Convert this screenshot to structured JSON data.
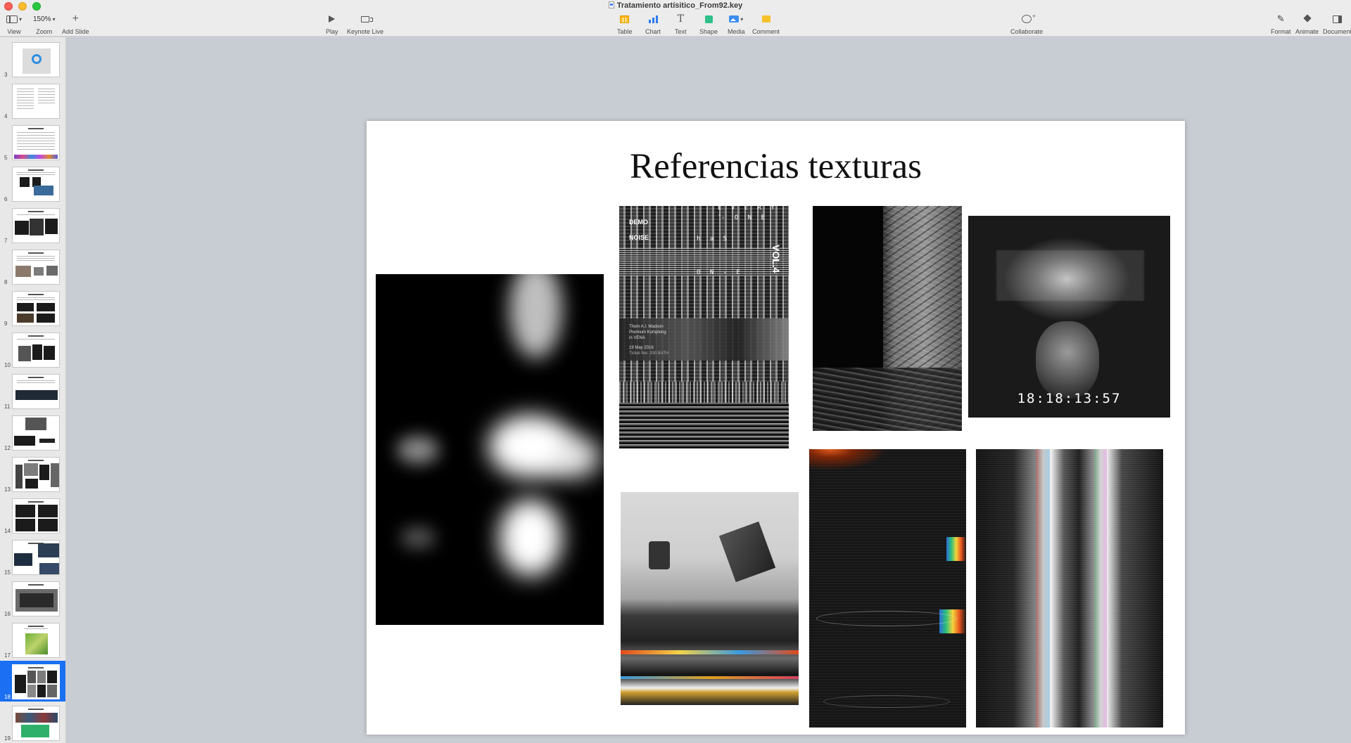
{
  "window": {
    "title": "Tratamiento artísitico_From92.key"
  },
  "toolbar": {
    "view_label": "View",
    "zoom_label": "Zoom",
    "zoom_value": "150%",
    "add_slide_label": "Add Slide",
    "play_label": "Play",
    "keynote_live_label": "Keynote Live",
    "table_label": "Table",
    "chart_label": "Chart",
    "text_label": "Text",
    "shape_label": "Shape",
    "media_label": "Media",
    "comment_label": "Comment",
    "collaborate_label": "Collaborate",
    "format_label": "Format",
    "animate_label": "Animate",
    "document_label": "Document"
  },
  "navigator": {
    "slides": [
      {
        "number": "3"
      },
      {
        "number": "4"
      },
      {
        "number": "5"
      },
      {
        "number": "6"
      },
      {
        "number": "7"
      },
      {
        "number": "8"
      },
      {
        "number": "9"
      },
      {
        "number": "10"
      },
      {
        "number": "11"
      },
      {
        "number": "12"
      },
      {
        "number": "13"
      },
      {
        "number": "14"
      },
      {
        "number": "15"
      },
      {
        "number": "16"
      },
      {
        "number": "17"
      },
      {
        "number": "18"
      },
      {
        "number": "19"
      }
    ],
    "selected": "18"
  },
  "slide": {
    "title": "Referencias texturas",
    "poster": {
      "line1": "E V E R Y -",
      "line2": "- O N E",
      "line3": "h a S",
      "line4": "O N - E",
      "vol": "VOL.4",
      "demo": "DEMO",
      "noise": "NOISE",
      "info1": "Thom A.I. Madson",
      "info2": "Premium Komplong",
      "info3": "in VENA",
      "date": "19 May 2016",
      "ticket": "Ticket fee: 200 BATH"
    },
    "timecode": "18:18:13:57"
  },
  "colors": {
    "selection": "#1a6ff2",
    "canvas_bg": "#c8cdd3",
    "slide_bg": "#ffffff"
  }
}
